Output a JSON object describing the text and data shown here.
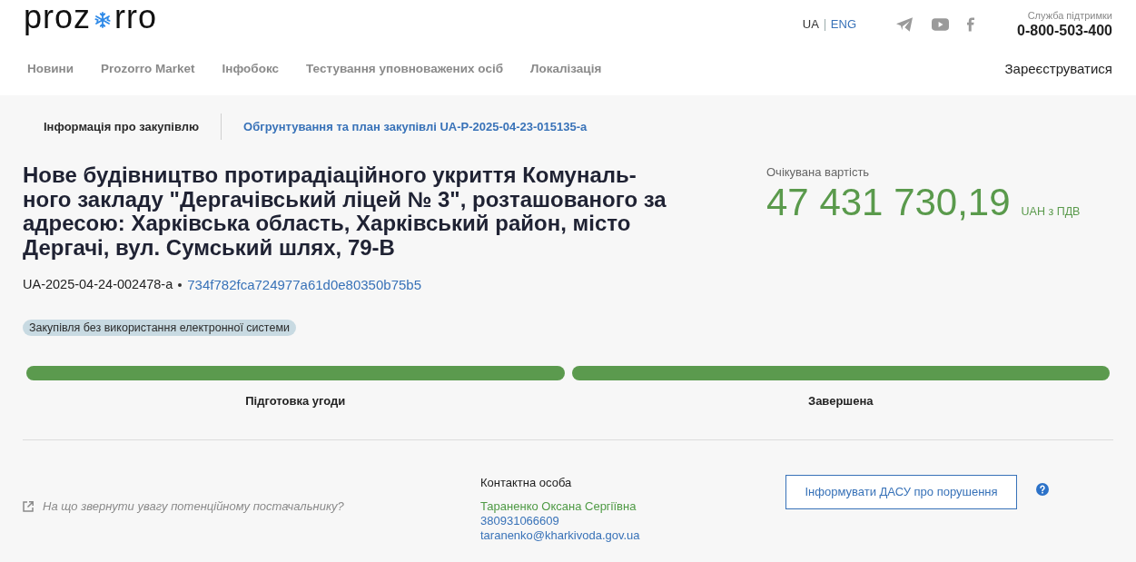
{
  "header": {
    "logo": {
      "before": "proz",
      "after": "rro"
    },
    "languages": [
      {
        "label": "UA",
        "selected": true
      },
      {
        "label": "ENG",
        "selected": false
      }
    ],
    "support": {
      "label": "Служба підтримки",
      "phone": "0-800-503-400"
    }
  },
  "nav": {
    "items": [
      "Новини",
      "Prozorro Market",
      "Інфобокс",
      "Тестування уповноважених осіб",
      "Локалізація"
    ],
    "register": "Зареєструватися"
  },
  "tabs": [
    {
      "label": "Інформація про закупівлю",
      "selected": true
    },
    {
      "label": "Обгрунтування та план закупівлі UA-P-2025-04-23-015135-a",
      "selected": false
    }
  ],
  "tender": {
    "title": "Нове будівництво протирадіаційного укриття Комуналь-ного закладу \"Дергачівський ліцей № 3\", розташованого за адресою: Харківська область, Харківський район, місто Дергачі, вул. Сумський шлях, 79-В",
    "id": "UA-2025-04-24-002478-a",
    "hash": "734f782fca724977a61d0e80350b75b5",
    "badge": "Закупівля без використання електронної системи"
  },
  "price": {
    "label": "Очікувана вартість",
    "amount": "47 431 730,19",
    "currency": "UAH з ПДВ"
  },
  "stages": [
    {
      "label": "Підготовка угоди",
      "done": true
    },
    {
      "label": "Завершена",
      "done": true
    }
  ],
  "footer": {
    "hint": "На що звернути увагу потенційному постачальнику?",
    "contact": {
      "heading": "Контактна особа",
      "name": "Тараненко Оксана Сергіївна",
      "phone": "380931066609",
      "email": "taranenko@kharkivoda.gov.ua"
    },
    "report_button": "Інформувати ДАСУ про порушення"
  }
}
